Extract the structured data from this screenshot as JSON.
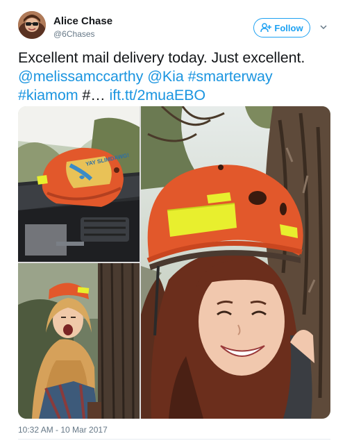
{
  "user": {
    "name": "Alice Chase",
    "handle": "@6Chases",
    "follow_label": "Follow"
  },
  "tweet": {
    "text_plain": "Excellent mail delivery today. Just excellent.",
    "mention_1": "@melissamccarthy",
    "mention_2": "@Kia",
    "hashtag_1": "#smarterway",
    "hashtag_2": "#kiamom",
    "truncated": "#…",
    "link": "ift.tt/2muaEBO",
    "timestamp": "10:32 AM - 10 Mar 2017"
  },
  "media": {
    "helmet_sticker_text": "YAY SLIMDAWG!"
  },
  "icons": {
    "follow": "add-user-icon",
    "menu": "chevron-down-icon"
  },
  "colors": {
    "link": "#1b95e0",
    "follow_accent": "#1da1f2",
    "helmet_orange": "#e2582b",
    "reflector_yellow": "#e8ef2e"
  }
}
